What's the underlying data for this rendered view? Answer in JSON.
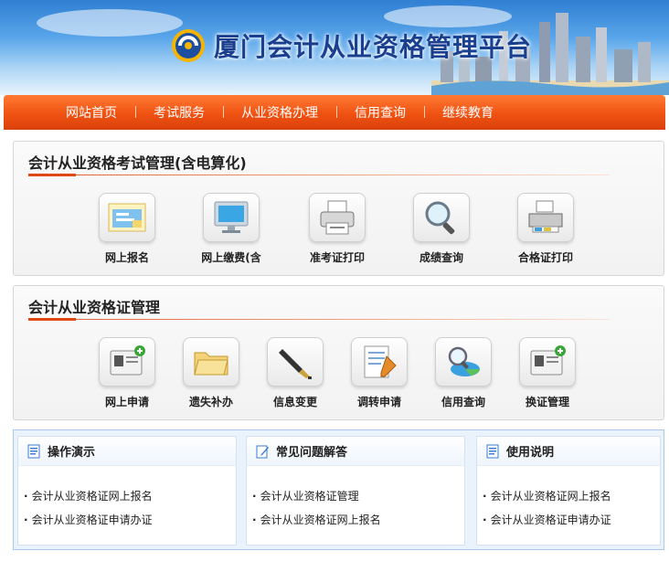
{
  "header": {
    "title": "厦门会计从业资格管理平台"
  },
  "nav": {
    "items": [
      "网站首页",
      "考试服务",
      "从业资格办理",
      "信用查询",
      "继续教育"
    ]
  },
  "exam_section": {
    "title": "会计从业资格考试管理(含电算化)",
    "tiles": [
      {
        "label": "网上报名",
        "icon": "online-signup-icon"
      },
      {
        "label": "网上缴费(含",
        "icon": "payment-monitor-icon"
      },
      {
        "label": "准考证打印",
        "icon": "printer-icon"
      },
      {
        "label": "成绩查询",
        "icon": "magnifier-icon"
      },
      {
        "label": "合格证打印",
        "icon": "color-printer-icon"
      }
    ]
  },
  "cert_section": {
    "title": "会计从业资格证管理",
    "tiles": [
      {
        "label": "网上申请",
        "icon": "add-card-icon"
      },
      {
        "label": "遗失补办",
        "icon": "folder-icon"
      },
      {
        "label": "信息变更",
        "icon": "fountain-pen-icon"
      },
      {
        "label": "调转申请",
        "icon": "document-edit-icon"
      },
      {
        "label": "信用查询",
        "icon": "search-chart-icon"
      },
      {
        "label": "换证管理",
        "icon": "add-card-icon"
      }
    ]
  },
  "info_boxes": [
    {
      "title": "操作演示",
      "items": [
        "会计从业资格证网上报名",
        "会计从业资格证申请办证"
      ]
    },
    {
      "title": "常见问题解答",
      "items": [
        "会计从业资格证管理",
        "会计从业资格证网上报名"
      ]
    },
    {
      "title": "使用说明",
      "items": [
        "会计从业资格证网上报名",
        "会计从业资格证申请办证"
      ]
    }
  ]
}
